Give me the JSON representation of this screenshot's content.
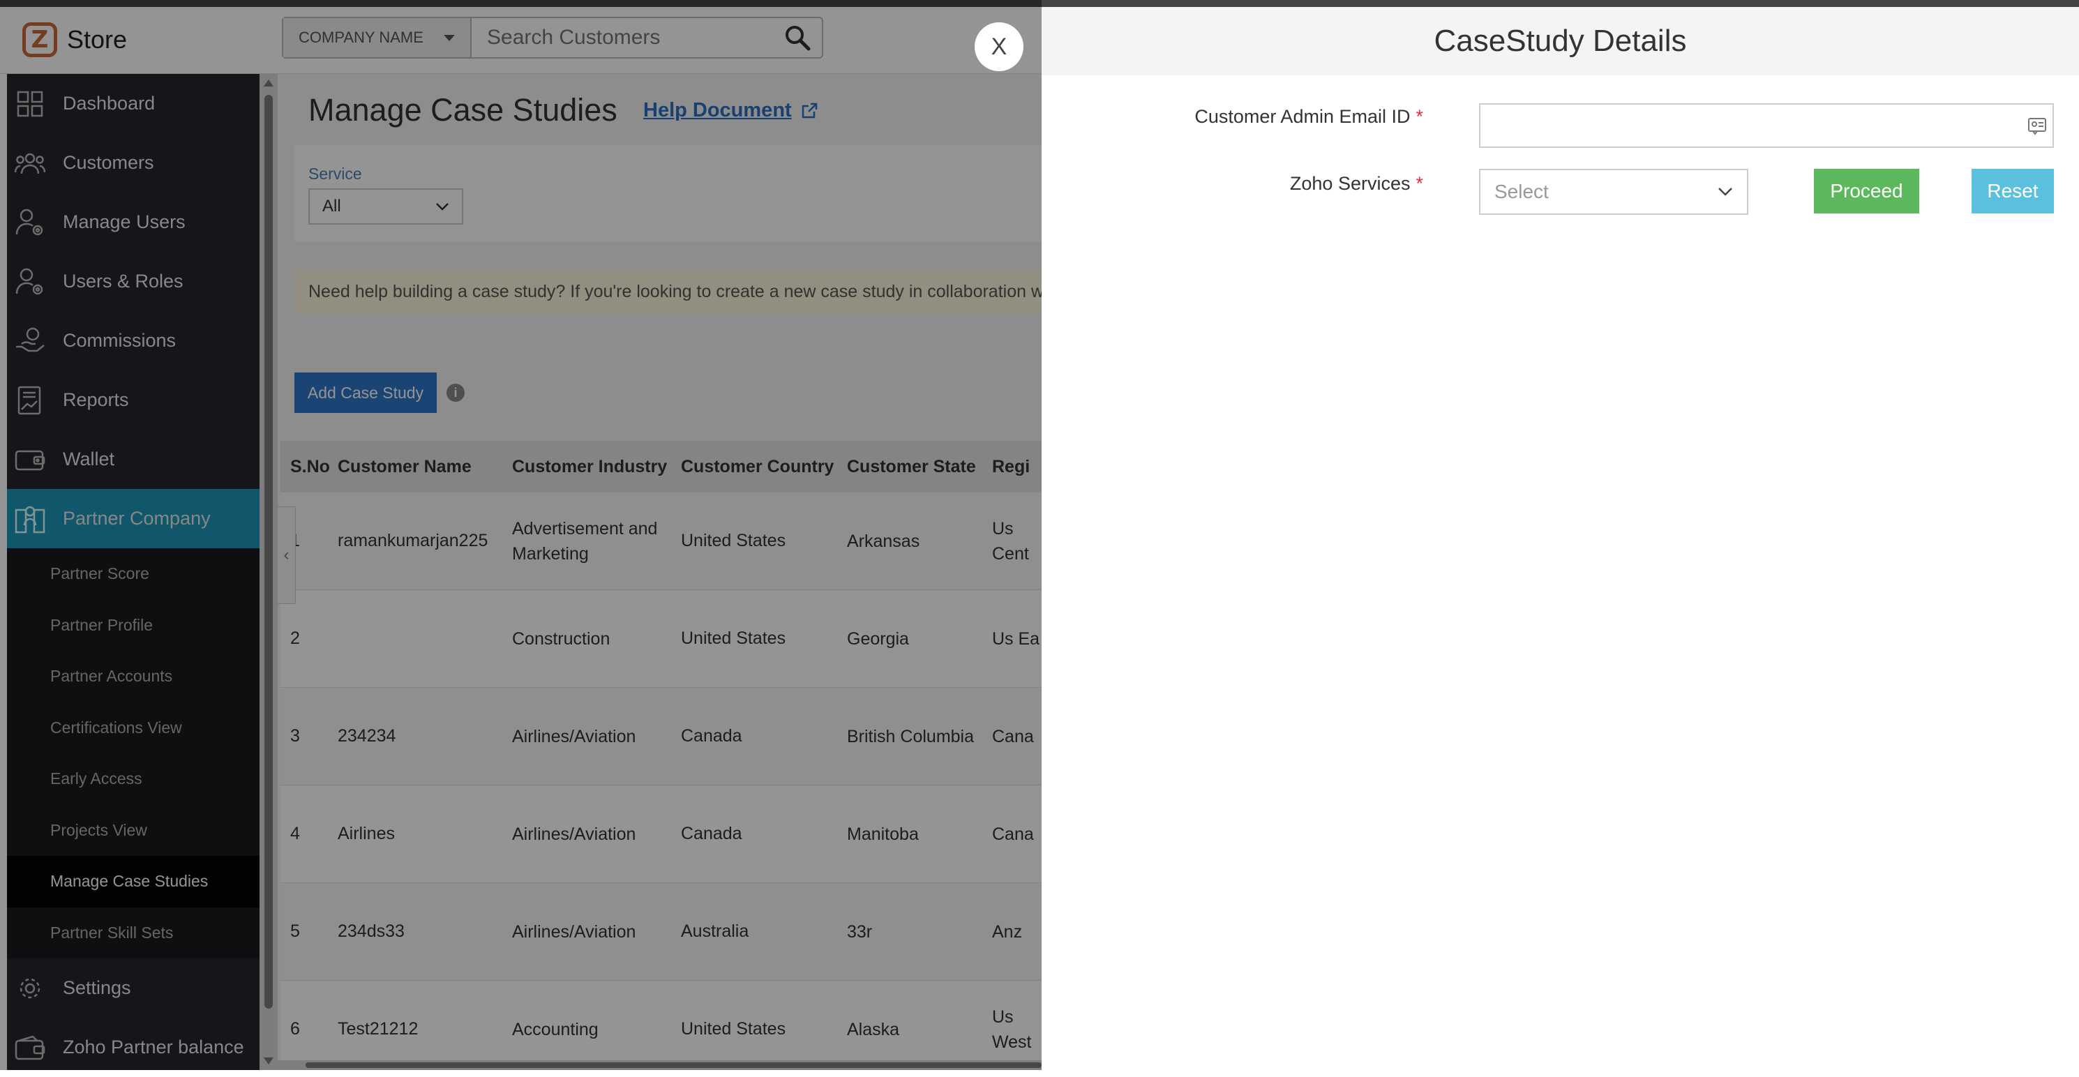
{
  "app": {
    "logo_text": "Store"
  },
  "search": {
    "company_dropdown": "COMPANY NAME",
    "placeholder": "Search Customers"
  },
  "sidebar": {
    "items": [
      {
        "label": "Dashboard",
        "icon": "dashboard-icon"
      },
      {
        "label": "Customers",
        "icon": "customers-icon"
      },
      {
        "label": "Manage Users",
        "icon": "manage-users-icon"
      },
      {
        "label": "Users & Roles",
        "icon": "users-roles-icon"
      },
      {
        "label": "Commissions",
        "icon": "commissions-icon"
      },
      {
        "label": "Reports",
        "icon": "reports-icon"
      },
      {
        "label": "Wallet",
        "icon": "wallet-icon"
      },
      {
        "label": "Partner Company",
        "icon": "partner-company-icon"
      }
    ],
    "sub_items": [
      "Partner Score",
      "Partner Profile",
      "Partner Accounts",
      "Certifications View",
      "Early Access",
      "Projects View",
      "Manage Case Studies",
      "Partner Skill Sets"
    ],
    "bottom_items": [
      {
        "label": "Settings",
        "icon": "settings-icon"
      },
      {
        "label": "Zoho Partner balance",
        "icon": "balance-icon"
      }
    ],
    "active_color": "#1e96b8"
  },
  "main": {
    "title": "Manage Case Studies",
    "help_link": "Help Document",
    "filter": {
      "label": "Service",
      "value": "All"
    },
    "notice": "Need help building a case study? If you're looking to create a new case study in collaboration w",
    "add_button": "Add Case Study",
    "table": {
      "headers": [
        "S.No",
        "Customer Name",
        "Customer Industry",
        "Customer Country",
        "Customer State",
        "Regi"
      ],
      "rows": [
        [
          "1",
          "ramankumarjan225",
          "Advertisement and Marketing",
          "United States",
          "Arkansas",
          "Us Cent"
        ],
        [
          "2",
          "",
          "Construction",
          "United States",
          "Georgia",
          "Us Ea"
        ],
        [
          "3",
          "234234",
          "Airlines/Aviation",
          "Canada",
          "British Columbia",
          "Cana"
        ],
        [
          "4",
          "Airlines",
          "Airlines/Aviation",
          "Canada",
          "Manitoba",
          "Cana"
        ],
        [
          "5",
          "234ds33",
          "Airlines/Aviation",
          "Australia",
          "33r",
          "Anz"
        ],
        [
          "6",
          "Test21212",
          "Accounting",
          "United States",
          "Alaska",
          "Us West"
        ]
      ]
    }
  },
  "drawer": {
    "close_label": "X",
    "title": "CaseStudy Details",
    "email_label": "Customer Admin Email ID",
    "email_value": "",
    "services_label": "Zoho Services",
    "services_placeholder": "Select",
    "required_mark": "*",
    "proceed": "Proceed",
    "reset": "Reset",
    "proceed_color": "#5cb85c",
    "reset_color": "#5bc0de"
  }
}
